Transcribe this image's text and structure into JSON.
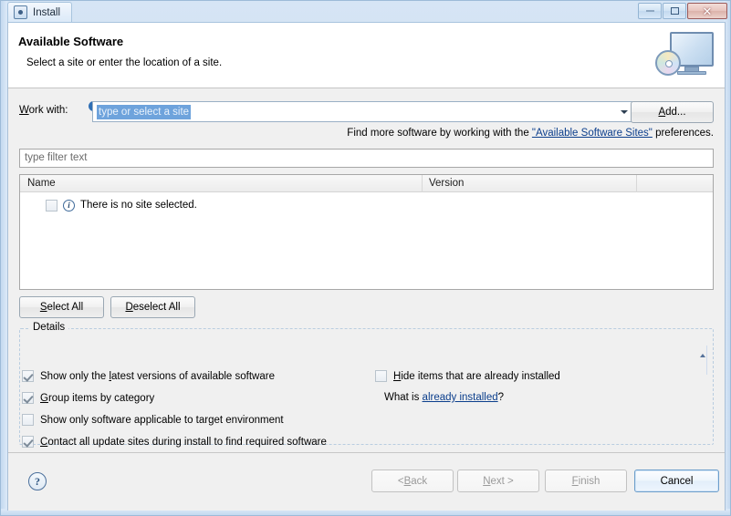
{
  "window": {
    "title": "Install",
    "icon": "install-gear-icon",
    "controls": {
      "minimize": "–",
      "maximize": "□",
      "close": "✕"
    }
  },
  "banner": {
    "title": "Available Software",
    "subtitle": "Select a site or enter the location of a site.",
    "art": "monitor-with-disc-icon"
  },
  "workwith": {
    "label_pre": "W",
    "label_post": "ork with:",
    "info_icon": "i",
    "value": "type or select a site",
    "add_label_pre": "A",
    "add_label_post": "dd..."
  },
  "hint": {
    "prefix": "Find more software by working with the ",
    "link": "\"Available Software Sites\"",
    "suffix": " preferences."
  },
  "filter": {
    "placeholder": "type filter text",
    "value": "type filter text"
  },
  "table": {
    "columns": [
      "Name",
      "Version",
      ""
    ],
    "rows": [
      {
        "checked": false,
        "icon": "info-icon",
        "name": "There is no site selected.",
        "version": ""
      }
    ]
  },
  "actions": {
    "select_all_pre": "S",
    "select_all_post": "elect All",
    "deselect_all_pre": "D",
    "deselect_all_post": "eselect All"
  },
  "details": {
    "legend": "Details"
  },
  "options": [
    {
      "id": "show-latest-versions",
      "checked": true,
      "pre": "Show only the ",
      "key": "l",
      "post": "atest versions of available software"
    },
    {
      "id": "group-by-category",
      "checked": true,
      "pre": "",
      "key": "G",
      "post": "roup items by category"
    },
    {
      "id": "show-applicable",
      "checked": false,
      "pre": "",
      "key": "S",
      "post": "how only software applicable to target environment"
    },
    {
      "id": "contact-update-sites",
      "checked": true,
      "pre": "",
      "key": "C",
      "post": "ontact all update sites during install to find required software"
    },
    {
      "id": "hide-installed",
      "checked": false,
      "pre": "",
      "key": "H",
      "post": "ide items that are already installed"
    }
  ],
  "whatis": {
    "prefix": "What is ",
    "link": "already installed",
    "suffix": "?"
  },
  "footer": {
    "help": "?",
    "back_pre": "< ",
    "back_key": "B",
    "back_post": "ack",
    "next_pre": "",
    "next_key": "N",
    "next_post": "ext >",
    "finish_pre": "",
    "finish_key": "F",
    "finish_post": "inish",
    "cancel": "Cancel"
  },
  "colors": {
    "accent": "#6ea3dc",
    "link": "#0b3e8c",
    "frame": "#c4d9ef",
    "dialog_bg": "#f0f0f0"
  }
}
